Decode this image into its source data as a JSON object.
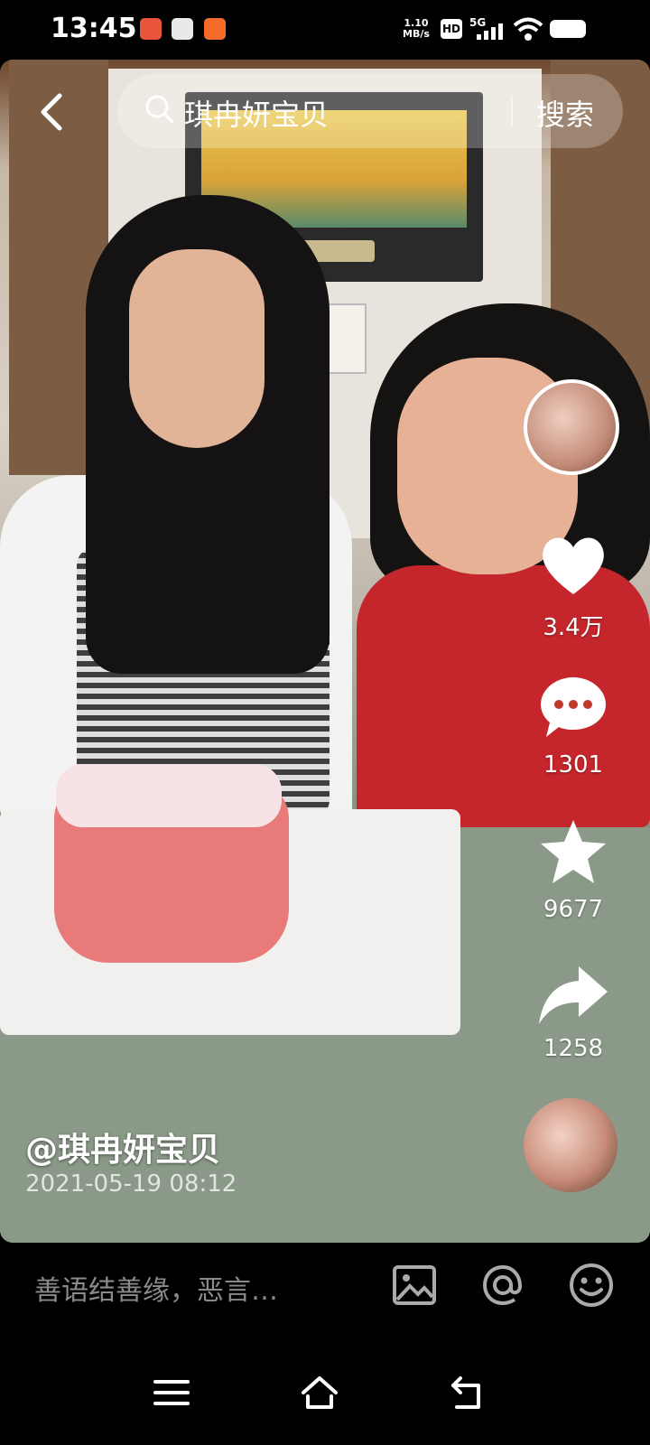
{
  "status_bar": {
    "time": "13:45",
    "net_speed_value": "1.10",
    "net_speed_unit": "MB/s",
    "hd_badge": "HD",
    "network": "5G"
  },
  "search": {
    "query": "琪冉妍宝贝",
    "button_label": "搜索"
  },
  "actions": {
    "like_count": "3.4万",
    "comment_count": "1301",
    "favorite_count": "9677",
    "share_count": "1258"
  },
  "post": {
    "author": "@琪冉妍宝贝",
    "date": "2021-05-19 08:12"
  },
  "comment_bar": {
    "placeholder": "善语结善缘，恶言…"
  },
  "icons": [
    "back-arrow-icon",
    "search-icon",
    "heart-icon",
    "comment-icon",
    "star-icon",
    "share-icon",
    "image-icon",
    "at-icon",
    "emoji-icon",
    "menu-icon",
    "home-icon",
    "back-icon"
  ]
}
